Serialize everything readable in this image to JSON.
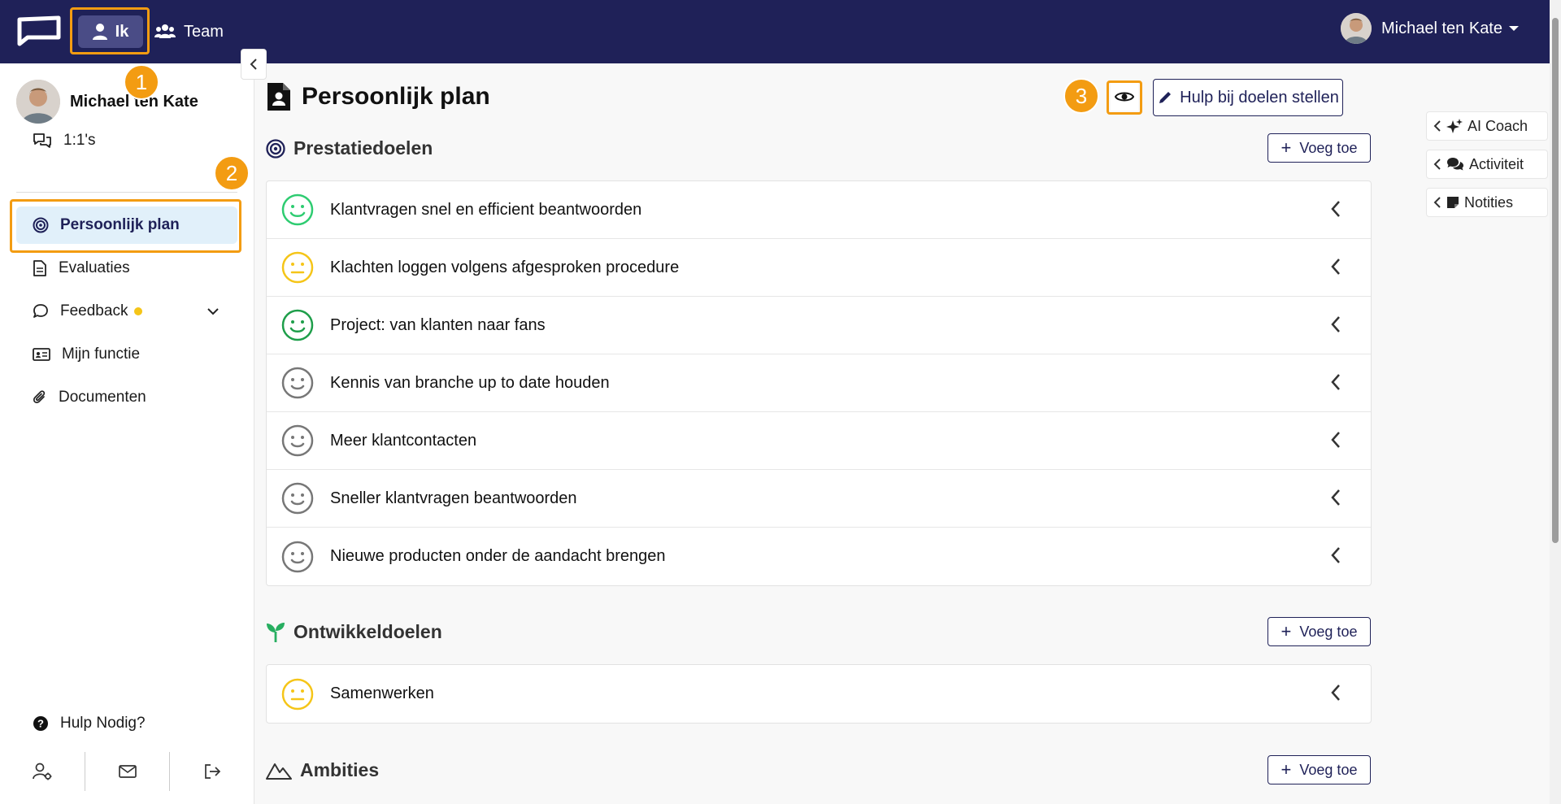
{
  "topnav": {
    "ik_label": "Ik",
    "team_label": "Team",
    "user_name": "Michael ten Kate"
  },
  "markers": {
    "one": "1",
    "two": "2",
    "three": "3"
  },
  "sidebar": {
    "profile_name": "Michael ten Kate",
    "items": [
      {
        "label": "1:1's",
        "icon": "chat-bubbles-icon"
      },
      {
        "label": "Persoonlijk plan",
        "icon": "target-icon"
      },
      {
        "label": "Evaluaties",
        "icon": "document-icon"
      },
      {
        "label": "Feedback",
        "icon": "speech-bubble-icon"
      },
      {
        "label": "Mijn functie",
        "icon": "id-card-icon"
      },
      {
        "label": "Documenten",
        "icon": "paperclip-icon"
      }
    ],
    "help_label": "Hulp Nodig?"
  },
  "main": {
    "title": "Persoonlijk plan",
    "help_button": "Hulp bij doelen stellen",
    "add_label": "Voeg toe",
    "sections": {
      "prestatie": {
        "title": "Prestatiedoelen",
        "goals": [
          {
            "title": "Klantvragen snel en efficient beantwoorden",
            "mood": "happy-green"
          },
          {
            "title": "Klachten loggen volgens afgesproken procedure",
            "mood": "neutral-yellow"
          },
          {
            "title": "Project: van klanten naar fans",
            "mood": "happy-darkgreen"
          },
          {
            "title": "Kennis van branche up to date houden",
            "mood": "neutral-grey"
          },
          {
            "title": "Meer klantcontacten",
            "mood": "neutral-grey"
          },
          {
            "title": "Sneller klantvragen beantwoorden",
            "mood": "neutral-grey"
          },
          {
            "title": "Nieuwe producten onder de aandacht brengen",
            "mood": "neutral-grey"
          }
        ]
      },
      "ontwikkel": {
        "title": "Ontwikkeldoelen",
        "goals": [
          {
            "title": "Samenwerken",
            "mood": "neutral-yellow"
          }
        ]
      },
      "ambities": {
        "title": "Ambities"
      }
    }
  },
  "right_panel": {
    "tabs": [
      "AI Coach",
      "Activiteit",
      "Notities"
    ]
  },
  "colors": {
    "nav_bg": "#1f2158",
    "accent": "#f39c12",
    "active_item_bg": "#e1f0fa",
    "happy_green": "#2ecc71",
    "happy_darkgreen": "#1e9e4a",
    "neutral_yellow": "#f5c518",
    "neutral_grey": "#777777"
  }
}
